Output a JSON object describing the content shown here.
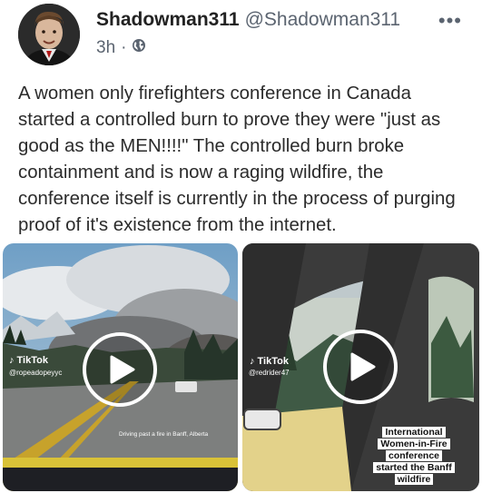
{
  "user": {
    "display_name": "Shadowman311",
    "handle": "@Shadowman311",
    "time": "3h",
    "dot": "·"
  },
  "menu": {
    "more_label": "•••"
  },
  "post": {
    "text": "A women only firefighters conference in Canada started a controlled burn to prove they were \"just as good as the MEN!!!!\" The controlled burn broke containment and is now a raging wildfire, the conference itself is currently in the process of purging proof of it's existence from the internet."
  },
  "media": [
    {
      "platform": "TikTok",
      "username": "@ropeadopeyyc",
      "caption": "Driving past a fire in Banff, Alberta"
    },
    {
      "platform": "TikTok",
      "username": "@redrider47",
      "caption_lines": [
        "International",
        "Women-in-Fire",
        "conference",
        "started the Banff",
        "wildfire"
      ]
    }
  ]
}
